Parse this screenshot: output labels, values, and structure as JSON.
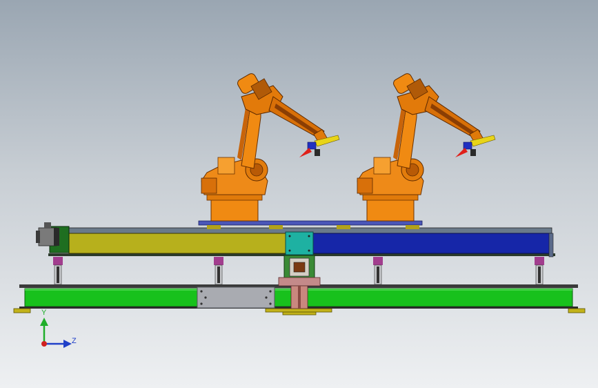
{
  "window": {
    "title": ""
  },
  "triad": {
    "axis_y": "Y",
    "axis_z": "Z"
  },
  "colors": {
    "background_top": "#9aa6b2",
    "background_bottom": "#eef0f2",
    "robot_orange": "#f08a12",
    "robot_dark": "#a04e08",
    "rail_blue": "#1626a8",
    "rail_olive": "#b9b21a",
    "base_green": "#16c41a",
    "carriage_teal": "#1fb0a0",
    "plate_gray": "#a8aab0"
  },
  "model": {
    "robots": [
      {
        "name": "robot-left"
      },
      {
        "name": "robot-right"
      }
    ],
    "legs_count": 4
  }
}
